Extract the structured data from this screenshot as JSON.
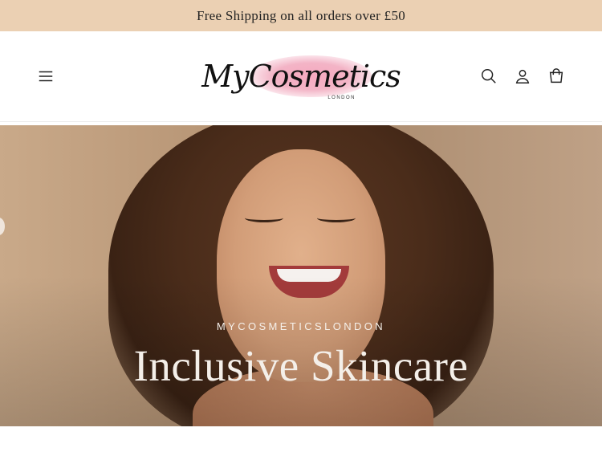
{
  "announcement": {
    "text": "Free Shipping on all orders over £50"
  },
  "header": {
    "logo_text": "MyCosmetics",
    "logo_sub": "LONDON",
    "icons": [
      "menu-icon",
      "search-icon",
      "account-icon",
      "cart-icon"
    ]
  },
  "hero": {
    "subheading": "MYCOSMETICSLONDON",
    "heading": "Inclusive Skincare"
  },
  "colors": {
    "announcement_bg": "#ebd0b3",
    "logo_accent": "#f3b4c6"
  }
}
